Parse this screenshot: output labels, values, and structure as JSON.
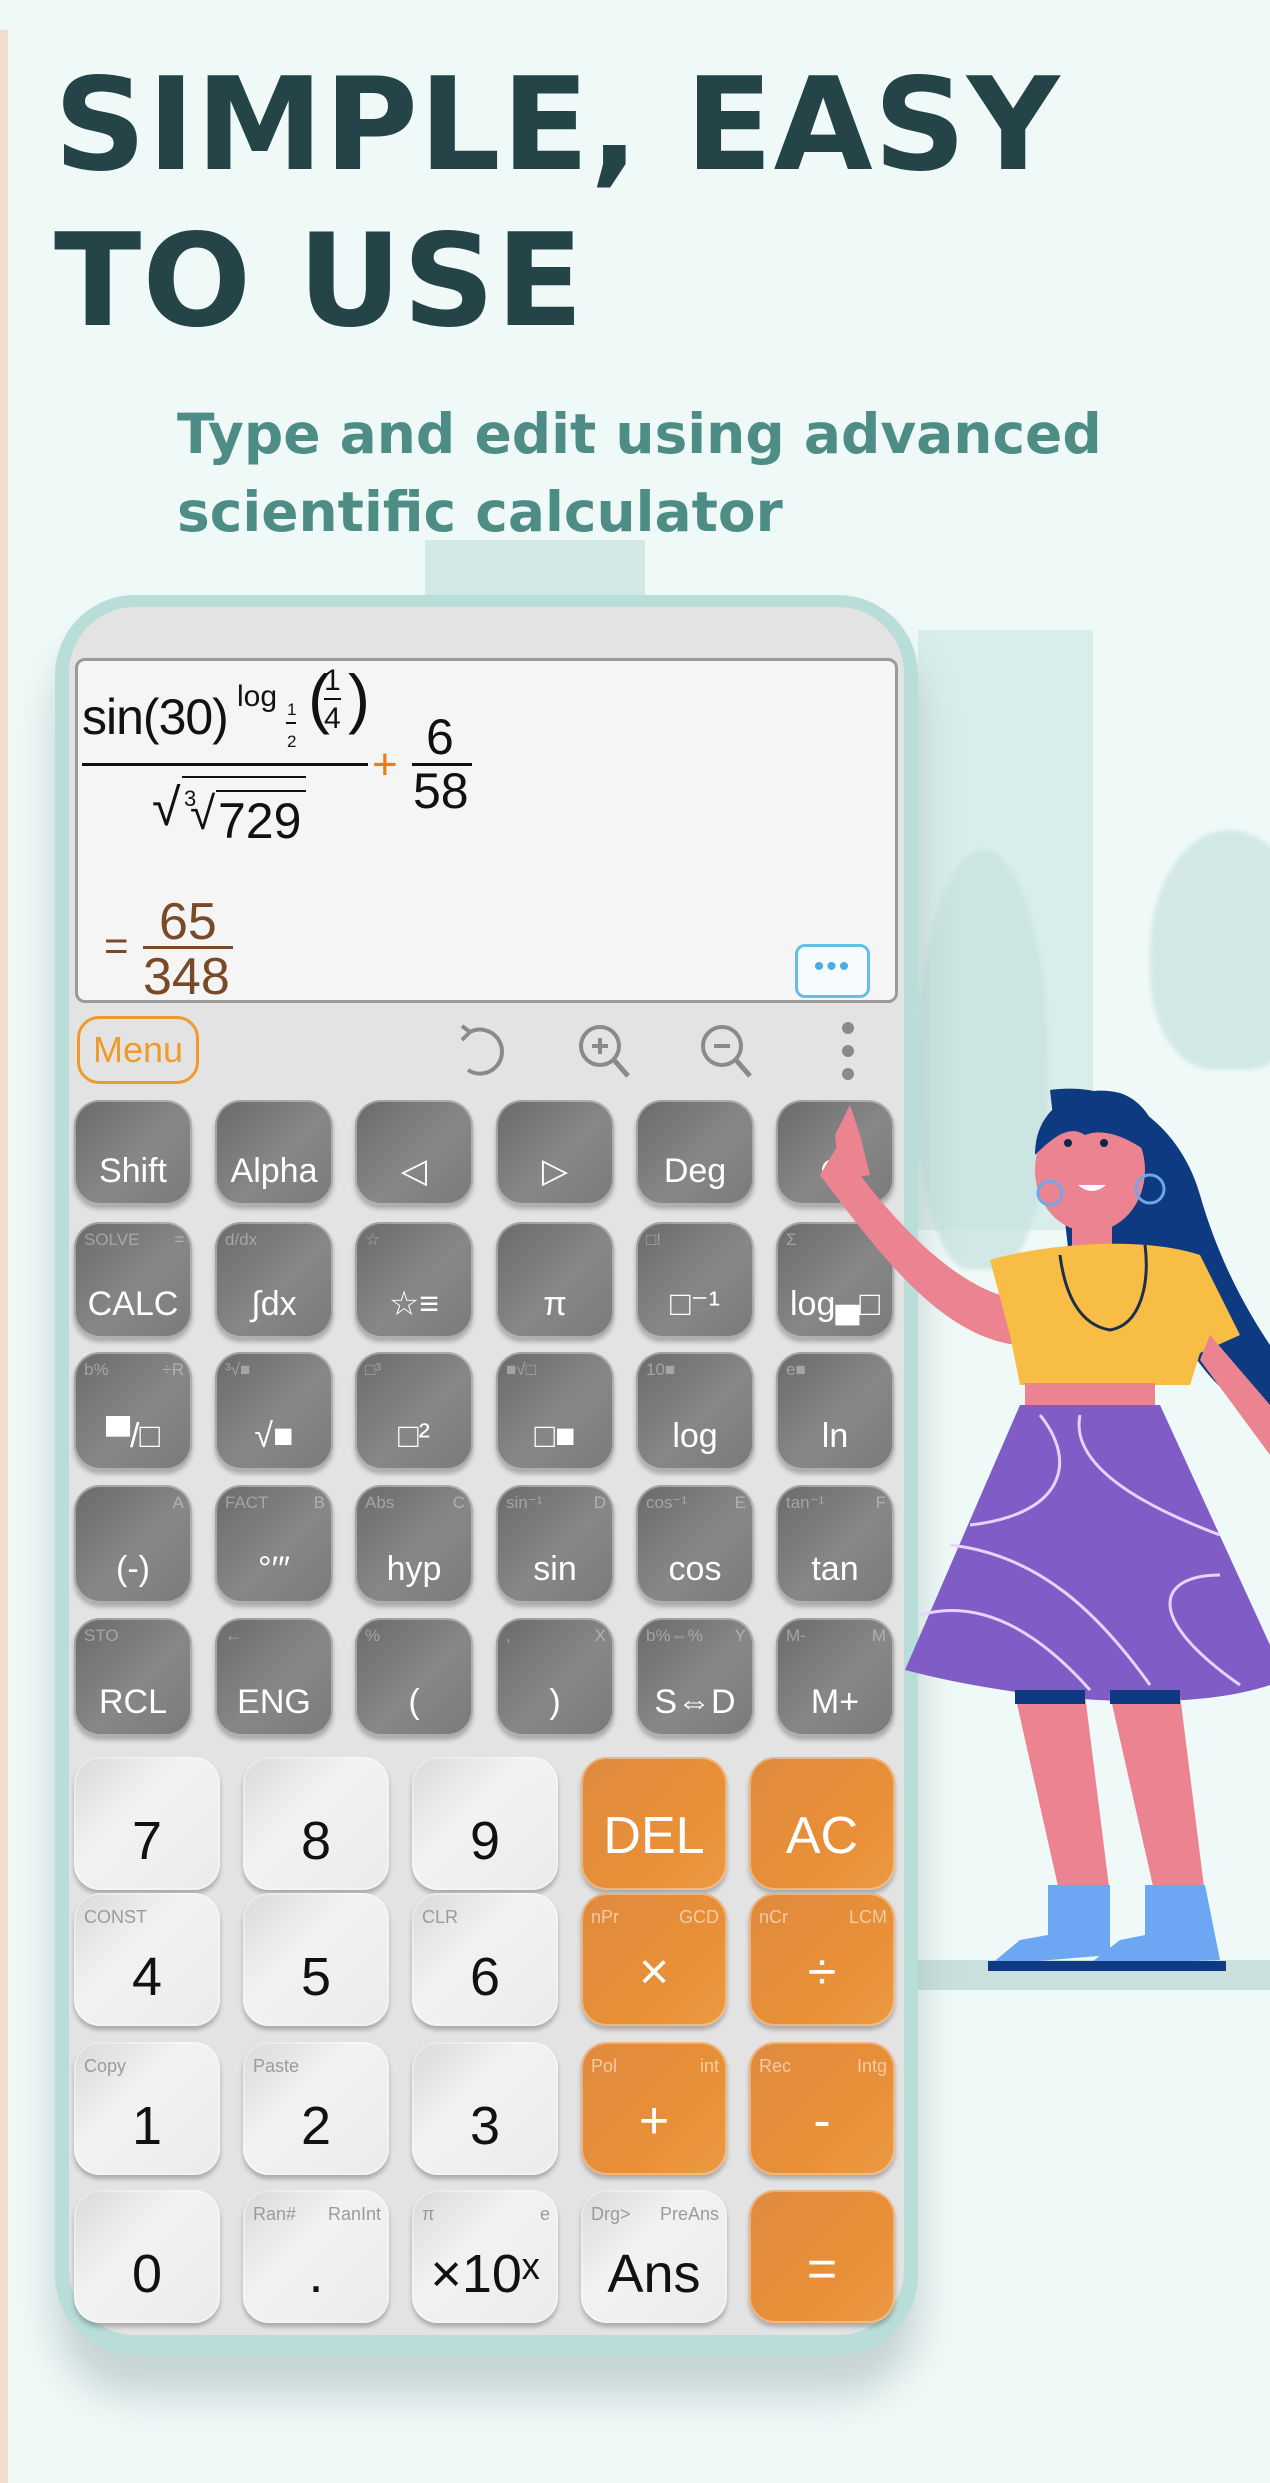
{
  "promo": {
    "headline_line1": "SIMPLE, EASY",
    "headline_line2": "TO USE",
    "subheadline_line1": "Type and edit using advanced",
    "subheadline_line2": "scientific calculator"
  },
  "display": {
    "expression": {
      "numerator_func": "sin(30)",
      "exponent_func": "log",
      "log_base_num": "1",
      "log_base_den": "2",
      "log_arg_num": "1",
      "log_arg_den": "4",
      "denominator_root_index": "3",
      "denominator_radicand": "729",
      "operator": "+",
      "fraction2_num": "6",
      "fraction2_den": "58"
    },
    "result": {
      "equals": "=",
      "numerator": "65",
      "denominator": "348"
    },
    "more_button_label": "•••"
  },
  "toolbar": {
    "menu_label": "Menu",
    "icons": [
      "undo-icon",
      "zoom-in-icon",
      "zoom-out-icon",
      "more-vertical-icon"
    ]
  },
  "function_keys": [
    [
      {
        "main": "Shift",
        "sub_l": "",
        "sub_r": ""
      },
      {
        "main": "Alpha",
        "sub_l": "",
        "sub_r": ""
      },
      {
        "main": "◁",
        "sub_l": "",
        "sub_r": ""
      },
      {
        "main": "▷",
        "sub_l": "",
        "sub_r": ""
      },
      {
        "main": "Deg",
        "sub_l": "",
        "sub_r": ""
      },
      {
        "main": "⟳",
        "sub_l": "",
        "sub_r": ""
      }
    ],
    [
      {
        "main": "CALC",
        "sub_l": "SOLVE",
        "sub_r": "="
      },
      {
        "main": "∫dx",
        "sub_l": "d/dx",
        "sub_r": ""
      },
      {
        "main": "☆≡",
        "sub_l": "☆",
        "sub_r": ""
      },
      {
        "main": "π",
        "sub_l": "",
        "sub_r": ""
      },
      {
        "main": "□⁻¹",
        "sub_l": "□!",
        "sub_r": ""
      },
      {
        "main": "log▄□",
        "sub_l": "Σ",
        "sub_r": "Π"
      }
    ],
    [
      {
        "main": "▀/□",
        "sub_l": "b%",
        "sub_r": "÷R"
      },
      {
        "main": "√■",
        "sub_l": "³√■",
        "sub_r": ""
      },
      {
        "main": "□²",
        "sub_l": "□³",
        "sub_r": ""
      },
      {
        "main": "□■",
        "sub_l": "■√□",
        "sub_r": ""
      },
      {
        "main": "log",
        "sub_l": "10■",
        "sub_r": ""
      },
      {
        "main": "ln",
        "sub_l": "e■",
        "sub_r": ""
      }
    ],
    [
      {
        "main": "(-)",
        "sub_l": "",
        "sub_r": "A"
      },
      {
        "main": "°′″",
        "sub_l": "FACT",
        "sub_r": "B"
      },
      {
        "main": "hyp",
        "sub_l": "Abs",
        "sub_r": "C"
      },
      {
        "main": "sin",
        "sub_l": "sin⁻¹",
        "sub_r": "D"
      },
      {
        "main": "cos",
        "sub_l": "cos⁻¹",
        "sub_r": "E"
      },
      {
        "main": "tan",
        "sub_l": "tan⁻¹",
        "sub_r": "F"
      }
    ],
    [
      {
        "main": "RCL",
        "sub_l": "STO",
        "sub_r": ""
      },
      {
        "main": "ENG",
        "sub_l": "←",
        "sub_r": ""
      },
      {
        "main": "(",
        "sub_l": "%",
        "sub_r": ""
      },
      {
        "main": ")",
        "sub_l": ",",
        "sub_r": "X"
      },
      {
        "main": "S⇔D",
        "sub_l": "b%⇔%",
        "sub_r": "Y"
      },
      {
        "main": "M+",
        "sub_l": "M-",
        "sub_r": "M"
      }
    ]
  ],
  "number_keys": [
    [
      {
        "main": "7",
        "sub_l": "",
        "sub_r": "",
        "style": "light"
      },
      {
        "main": "8",
        "sub_l": "",
        "sub_r": "",
        "style": "light"
      },
      {
        "main": "9",
        "sub_l": "",
        "sub_r": "",
        "style": "light"
      },
      {
        "main": "DEL",
        "sub_l": "",
        "sub_r": "",
        "style": "orange"
      },
      {
        "main": "AC",
        "sub_l": "",
        "sub_r": "",
        "style": "orange"
      }
    ],
    [
      {
        "main": "4",
        "sub_l": "CONST",
        "sub_r": "",
        "style": "light"
      },
      {
        "main": "5",
        "sub_l": "",
        "sub_r": "",
        "style": "light"
      },
      {
        "main": "6",
        "sub_l": "CLR",
        "sub_r": "",
        "style": "light"
      },
      {
        "main": "×",
        "sub_l": "nPr",
        "sub_r": "GCD",
        "style": "orange"
      },
      {
        "main": "÷",
        "sub_l": "nCr",
        "sub_r": "LCM",
        "style": "orange"
      }
    ],
    [
      {
        "main": "1",
        "sub_l": "Copy",
        "sub_r": "",
        "style": "light"
      },
      {
        "main": "2",
        "sub_l": "Paste",
        "sub_r": "",
        "style": "light"
      },
      {
        "main": "3",
        "sub_l": "",
        "sub_r": "",
        "style": "light"
      },
      {
        "main": "+",
        "sub_l": "Pol",
        "sub_r": "int",
        "style": "orange"
      },
      {
        "main": "-",
        "sub_l": "Rec",
        "sub_r": "Intg",
        "style": "orange"
      }
    ],
    [
      {
        "main": "0",
        "sub_l": "",
        "sub_r": "",
        "style": "light"
      },
      {
        "main": ".",
        "sub_l": "Ran#",
        "sub_r": "RanInt",
        "style": "light"
      },
      {
        "main": "×10ˣ",
        "sub_l": "π",
        "sub_r": "e",
        "style": "light"
      },
      {
        "main": "Ans",
        "sub_l": "Drg>",
        "sub_r": "PreAns",
        "style": "light"
      },
      {
        "main": "=",
        "sub_l": "",
        "sub_r": "",
        "style": "orange"
      }
    ]
  ],
  "colors": {
    "headline": "#244447",
    "subheadline": "#4e8d86",
    "accent_orange": "#e88f37",
    "phone_frame": "#b9ddd9",
    "result_brown": "#7a4a28",
    "more_button_blue": "#4aaee6"
  }
}
